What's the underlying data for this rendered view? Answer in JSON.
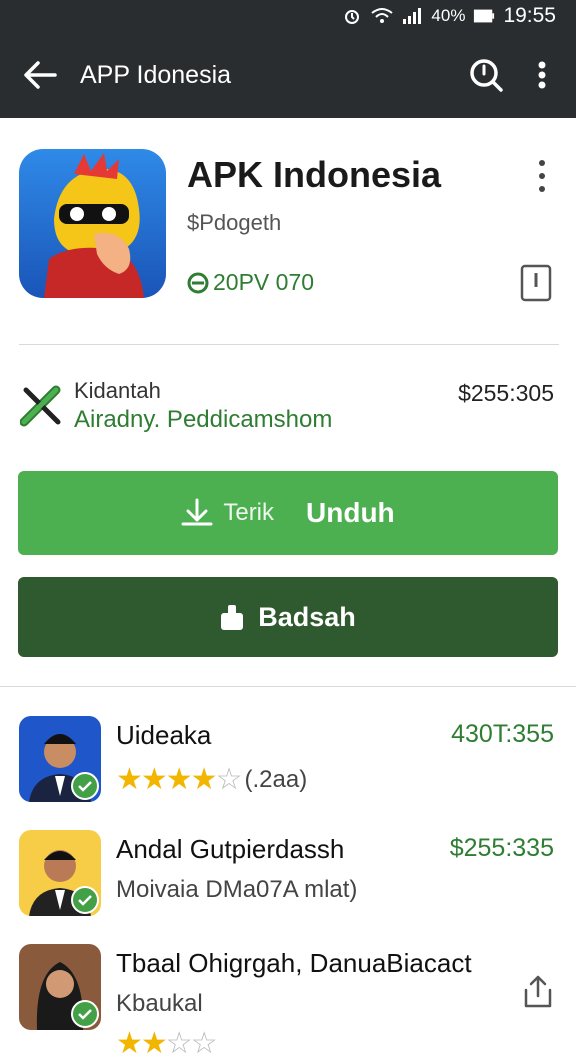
{
  "status_bar": {
    "battery": "40%",
    "time": "19:55"
  },
  "app_bar": {
    "title": "APP Idonesia"
  },
  "app": {
    "name": "APK Indonesia",
    "developer": "$Pdogeth",
    "rating_text": "20PV 070"
  },
  "info": {
    "line1": "Kidantah",
    "line2": "Airadny. Peddicamshom",
    "size": "$255:305"
  },
  "buttons": {
    "primary_sub": "Terik",
    "primary_main": "Unduh",
    "secondary_main": "Badsah"
  },
  "list": [
    {
      "name": "Uideaka",
      "price": "430T:355",
      "rating_extra": "(.2aa)",
      "stars": 4
    },
    {
      "name": "Andal Gutpierdassh",
      "price": "$255:335",
      "subtitle": "Moivaia DMa07A mlat)"
    },
    {
      "name": "Tbaal Ohigrgah, DanuaBiacact",
      "subtitle": "Kbaukal",
      "stars": 2
    }
  ],
  "colors": {
    "appbar": "#2a2d2f",
    "accent": "#4caf50",
    "dark_accent": "#2f5a2f",
    "star": "#f2b600"
  },
  "icons": [
    "back-arrow-icon",
    "search-icon",
    "more-vert-icon",
    "bookmark-icon",
    "rating-icon",
    "tool-icon",
    "download-icon",
    "lock-icon",
    "verified-badge-icon",
    "share-icon"
  ]
}
